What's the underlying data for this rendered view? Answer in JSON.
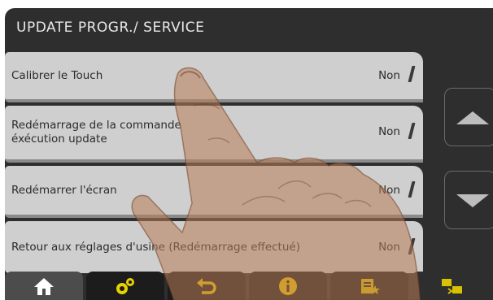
{
  "screen": {
    "title": "UPDATE PROGR./ SERVICE"
  },
  "rows": [
    {
      "label": "Calibrer le Touch",
      "value": "Non"
    },
    {
      "label": "Redémarrage de la commande\néxécution update",
      "value": "Non"
    },
    {
      "label": "Redémarrer l'écran",
      "value": "Non"
    },
    {
      "label": "Retour aux réglages d'usine (Redémarrage effectué)",
      "value": "Non"
    }
  ],
  "side": {
    "up_icon": "triangle-up",
    "down_icon": "triangle-down"
  },
  "tabs": [
    {
      "name": "home",
      "icon": "home-icon",
      "color": "#ffffff"
    },
    {
      "name": "settings",
      "icon": "gears-icon",
      "color": "#e6d200"
    },
    {
      "name": "back",
      "icon": "undo-arrow-icon",
      "color": "#f0c400"
    },
    {
      "name": "info",
      "icon": "info-icon",
      "color": "#f0c400"
    },
    {
      "name": "favorites",
      "icon": "document-star-icon",
      "color": "#d9c000"
    },
    {
      "name": "transfer",
      "icon": "transfer-icon",
      "color": "#d9c000"
    }
  ]
}
